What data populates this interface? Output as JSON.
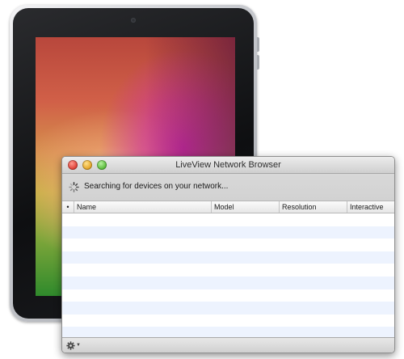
{
  "window": {
    "title": "LiveView Network Browser",
    "status_text": "Searching for devices on your network..."
  },
  "table": {
    "columns": [
      "•",
      "Name",
      "Model",
      "Resolution",
      "Interactive"
    ],
    "rows": []
  },
  "icons": {
    "spinner": "spinner-icon",
    "gear": "gear-icon",
    "gear_caret": "chevron-down-icon"
  },
  "colors": {
    "close": "#e0443a",
    "minimize": "#e6a82b",
    "zoom": "#5fbf3f",
    "row_alt": "#edf3fe"
  }
}
